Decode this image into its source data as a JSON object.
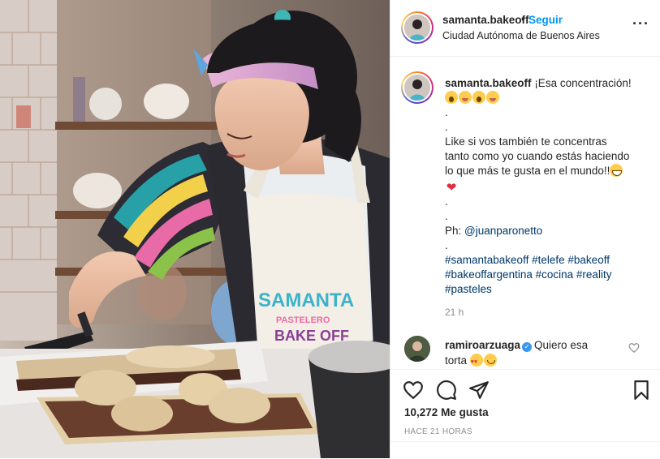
{
  "post": {
    "author": {
      "username": "samanta.bakeoff",
      "location": "Ciudad Autónoma de Buenos Aires",
      "follow_label": "Seguir",
      "separator": "•"
    },
    "more_icon": "more-horizontal-icon",
    "caption": {
      "username": "samanta.bakeoff",
      "lines": [
        "¡Esa concentración!",
        "",
        ".",
        ".",
        "Like si vos también te concentras",
        "tanto como yo cuando estás haciendo",
        "lo que más te gusta en el mundo!!",
        "",
        ".",
        ".",
        "Ph: ",
        "."
      ],
      "mention": "@juanparonetto",
      "hashtags_line1": [
        "#samantabakeoff",
        "#telefe",
        "#bakeoff"
      ],
      "hashtags_line2": [
        "#bakeoffargentina",
        "#cocina",
        "#reality"
      ],
      "hashtags_line3": [
        "#pasteles"
      ],
      "time_ago": "21 h",
      "emojis_line1": [
        "face-screaming-emoji",
        "face-savoring-food-emoji",
        "face-screaming-emoji",
        "face-savoring-food-emoji"
      ],
      "emoji_line7": "grinning-face-emoji",
      "emoji_line8": "heart-emoji"
    },
    "comments": [
      {
        "username": "ramiroarzuaga",
        "verified": true,
        "text_line1": "Quiero esa",
        "text_line2": "torta",
        "emojis": [
          "heart-eyes-emoji",
          "smiling-face-emoji"
        ],
        "like_icon": "heart-outline-icon"
      }
    ],
    "actions": {
      "like_icon": "heart-outline-icon",
      "comment_icon": "comment-bubble-icon",
      "share_icon": "paper-plane-icon",
      "save_icon": "bookmark-icon"
    },
    "likes": {
      "count": "10,272",
      "label": "Me gusta"
    },
    "timestamp": "HACE 21 HORAS",
    "colors": {
      "link_blue": "#0095f6",
      "hashtag_blue": "#00376b",
      "text": "#262626",
      "muted": "#8e8e8e",
      "verified_blue": "#3897f0",
      "heart_red": "#dd2e44"
    }
  },
  "photo": {
    "apron_text_line1": "SAMANTA",
    "apron_text_line2": "PASTELERO",
    "apron_text_line3": "BAKE OFF"
  }
}
